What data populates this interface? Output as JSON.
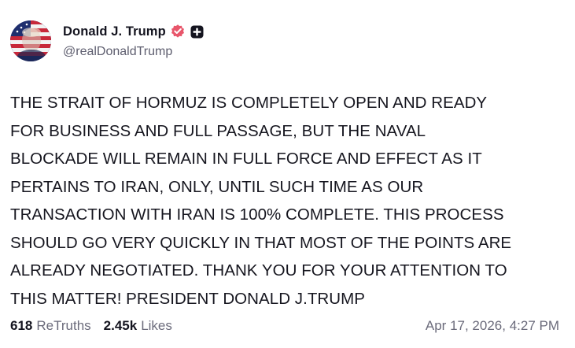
{
  "author": {
    "display_name": "Donald J. Trump",
    "handle": "@realDonaldTrump",
    "verified_badge": "verified-badge-icon",
    "extra_badge": "plus-badge-icon",
    "accent_color": "#e8566b"
  },
  "post": {
    "lines": [
      "THE STRAIT OF HORMUZ IS COMPLETELY OPEN AND READY",
      "FOR BUSINESS AND FULL PASSAGE, BUT THE NAVAL",
      "BLOCKADE WILL REMAIN IN FULL FORCE AND EFFECT AS IT",
      "PERTAINS TO IRAN, ONLY, UNTIL SUCH TIME AS OUR",
      "TRANSACTION WITH IRAN IS 100% COMPLETE. THIS PROCESS",
      "SHOULD GO VERY QUICKLY IN THAT MOST OF THE POINTS ARE",
      "ALREADY NEGOTIATED. THANK YOU FOR YOUR ATTENTION TO",
      "THIS MATTER! PRESIDENT DONALD J.TRUMP"
    ]
  },
  "stats": {
    "retruths_count": "618",
    "retruths_label": "ReTruths",
    "likes_count": "2.45k",
    "likes_label": "Likes"
  },
  "timestamp": "Apr 17, 2026, 4:27 PM"
}
